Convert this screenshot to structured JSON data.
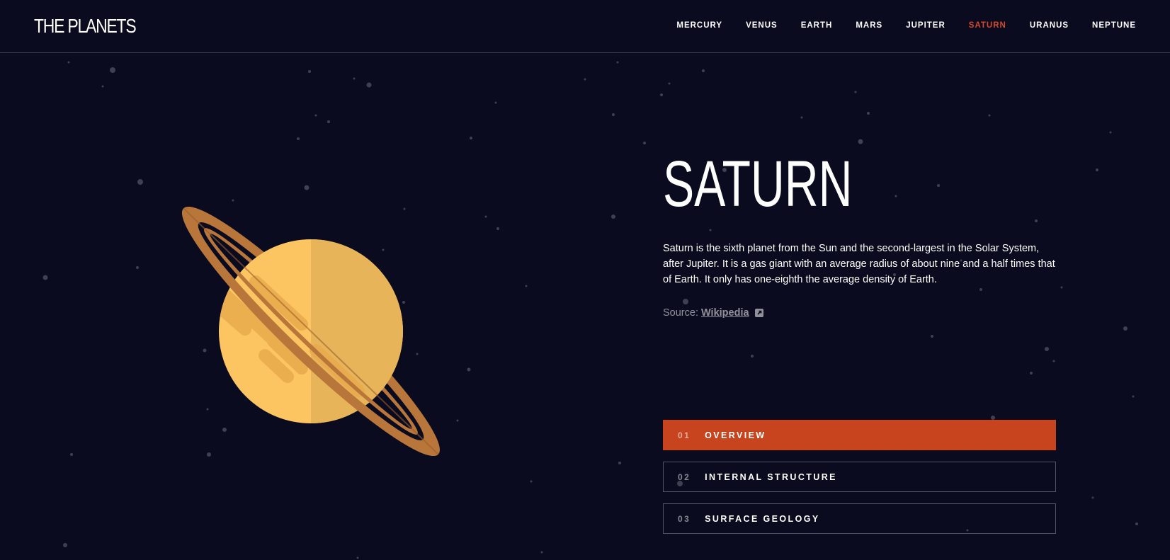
{
  "header": {
    "logo": "THE PLANETS",
    "nav": [
      {
        "label": "MERCURY",
        "active": false
      },
      {
        "label": "VENUS",
        "active": false
      },
      {
        "label": "EARTH",
        "active": false
      },
      {
        "label": "MARS",
        "active": false
      },
      {
        "label": "JUPITER",
        "active": false
      },
      {
        "label": "SATURN",
        "active": true
      },
      {
        "label": "URANUS",
        "active": false
      },
      {
        "label": "NEPTUNE",
        "active": false
      }
    ]
  },
  "planet": {
    "name": "SATURN",
    "description": "Saturn is the sixth planet from the Sun and the second-largest in the Solar System, after Jupiter. It is a gas giant with an average radius of about nine and a half times that of Earth. It only has one-eighth the average density of Earth.",
    "source_prefix": "Source:",
    "source_link": "Wikipedia",
    "image_icon": "saturn-illustration"
  },
  "tabs": [
    {
      "num": "01",
      "label": "OVERVIEW",
      "active": true
    },
    {
      "num": "02",
      "label": "INTERNAL STRUCTURE",
      "active": false
    },
    {
      "num": "03",
      "label": "SURFACE GEOLOGY",
      "active": false
    }
  ],
  "colors": {
    "background": "#0a0b1f",
    "accent": "#c8441f",
    "active_nav": "#d8472a",
    "planet_light": "#fcc561",
    "planet_shade": "#e8b45a",
    "ring": "#b9763a"
  }
}
